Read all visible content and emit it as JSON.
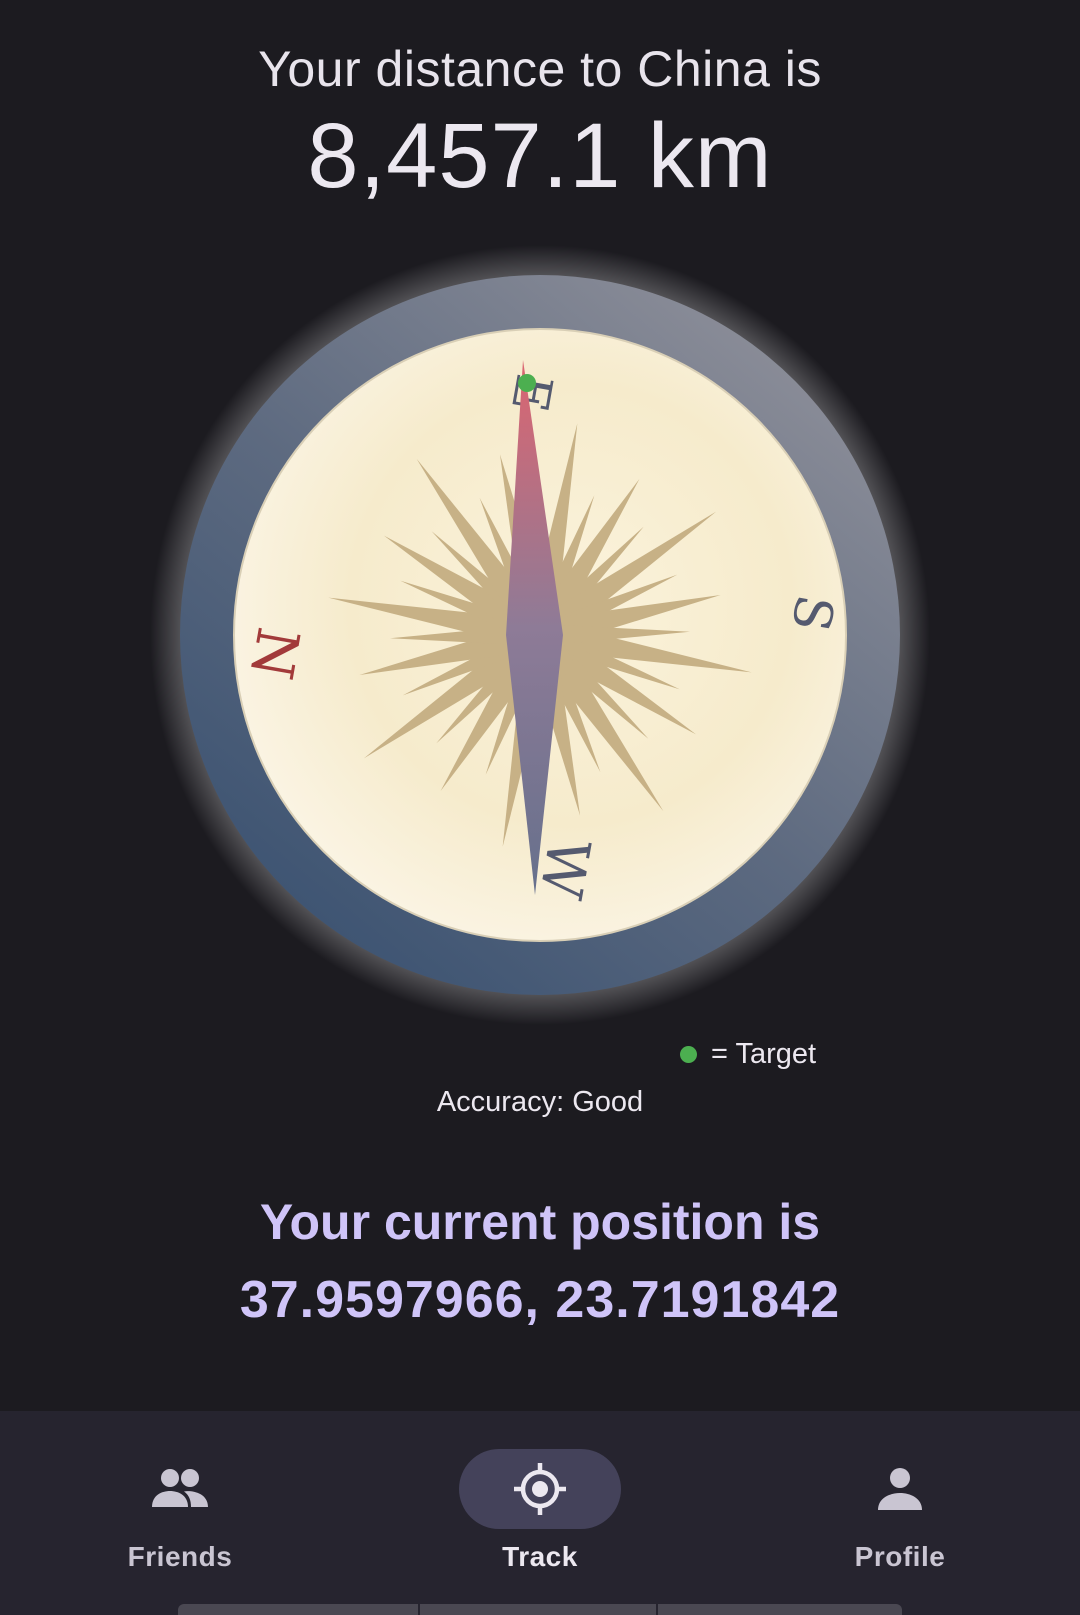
{
  "distance": {
    "label": "Your distance to China is",
    "value": "8,457.1 km"
  },
  "compass": {
    "cardinals": {
      "north": "N",
      "east": "E",
      "south": "S",
      "west": "W"
    },
    "target_marker_color": "#4caf50",
    "needle_colors": {
      "north": "#d2666e",
      "south": "#6f7b96"
    },
    "rose_color": "#c7b186"
  },
  "legend": {
    "label": "= Target"
  },
  "accuracy": {
    "text": "Accuracy: Good"
  },
  "position": {
    "label": "Your current position is",
    "value": "37.9597966, 23.7191842"
  },
  "nav": {
    "items": [
      {
        "label": "Friends",
        "icon": "people-icon",
        "active": false
      },
      {
        "label": "Track",
        "icon": "crosshair-icon",
        "active": true
      },
      {
        "label": "Profile",
        "icon": "person-icon",
        "active": false
      }
    ]
  },
  "colors": {
    "background": "#1c1b20",
    "accent": "#cfc4f8",
    "navbar": "#26242f"
  }
}
